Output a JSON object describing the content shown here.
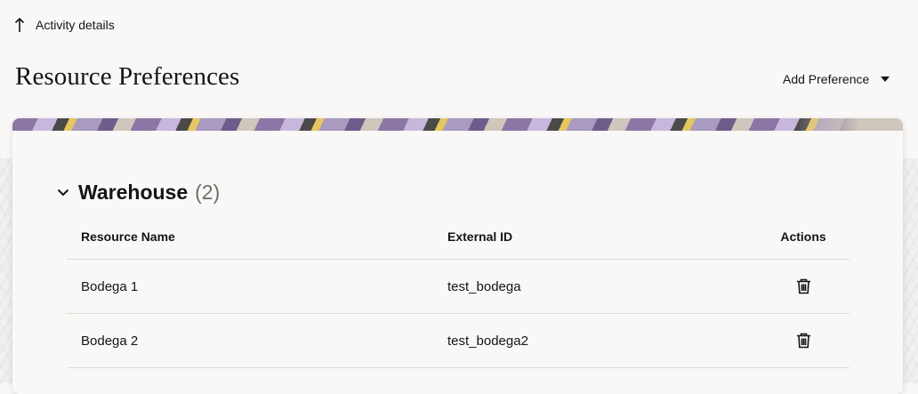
{
  "nav": {
    "back_label": "Activity details"
  },
  "page": {
    "title": "Resource Preferences",
    "add_preference_label": "Add Preference"
  },
  "section": {
    "title": "Warehouse",
    "count": "(2)"
  },
  "table": {
    "headers": {
      "name": "Resource Name",
      "external_id": "External ID",
      "actions": "Actions"
    },
    "rows": [
      {
        "name": "Bodega 1",
        "external_id": "test_bodega"
      },
      {
        "name": "Bodega 2",
        "external_id": "test_bodega2"
      }
    ]
  },
  "icons": {
    "back": "arrow-up-icon",
    "dropdown": "caret-down-icon",
    "collapse": "chevron-down-icon",
    "delete": "trash-icon"
  }
}
